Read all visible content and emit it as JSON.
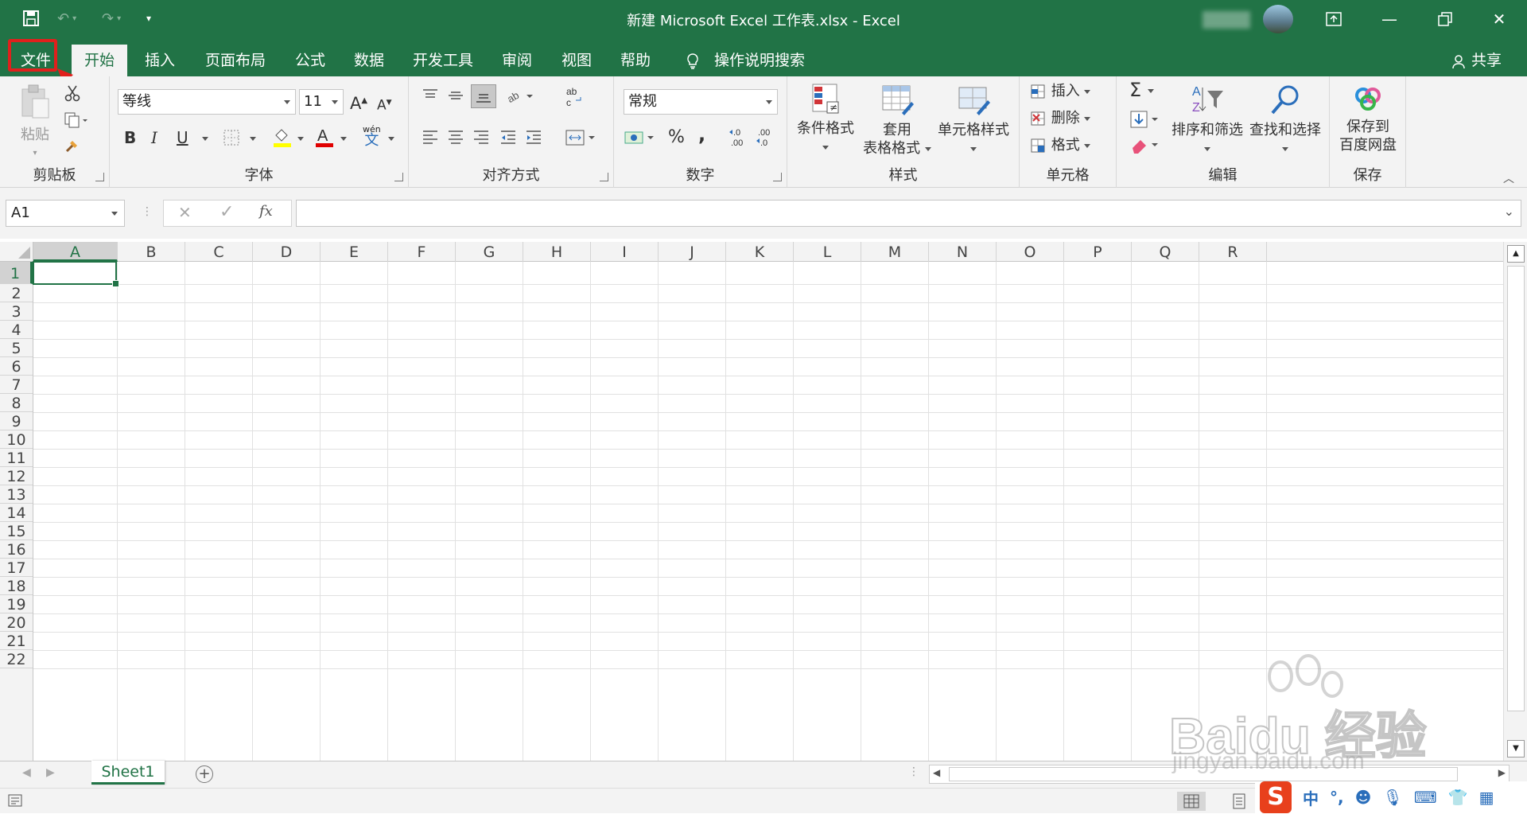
{
  "window": {
    "title": "新建 Microsoft Excel 工作表.xlsx  -  Excel"
  },
  "tabs": [
    {
      "label": "文件"
    },
    {
      "label": "开始"
    },
    {
      "label": "插入"
    },
    {
      "label": "页面布局"
    },
    {
      "label": "公式"
    },
    {
      "label": "数据"
    },
    {
      "label": "开发工具"
    },
    {
      "label": "审阅"
    },
    {
      "label": "视图"
    },
    {
      "label": "帮助"
    }
  ],
  "tell_me": "操作说明搜索",
  "share": "共享",
  "ribbon": {
    "clipboard": {
      "label": "剪贴板",
      "paste": "粘贴"
    },
    "font": {
      "label": "字体",
      "name": "等线",
      "size": "11",
      "bold": "B",
      "italic": "I",
      "underline": "U",
      "phonetic": "wén",
      "phonetic2": "文"
    },
    "alignment": {
      "label": "对齐方式"
    },
    "number": {
      "label": "数字",
      "format": "常规",
      "percent": "%",
      "comma": ","
    },
    "styles": {
      "label": "样式",
      "conditional": "条件格式",
      "table_1": "套用",
      "table_2": "表格格式",
      "cell_styles": "单元格样式"
    },
    "cells": {
      "label": "单元格",
      "insert": "插入",
      "delete": "删除",
      "format": "格式"
    },
    "editing": {
      "label": "编辑",
      "sort": "排序和筛选",
      "find": "查找和选择"
    },
    "save": {
      "label": "保存",
      "btn_1": "保存到",
      "btn_2": "百度网盘"
    }
  },
  "formula_bar": {
    "name_box": "A1",
    "fx": "fx",
    "value": ""
  },
  "columns": [
    "A",
    "B",
    "C",
    "D",
    "E",
    "F",
    "G",
    "H",
    "I",
    "J",
    "K",
    "L",
    "M",
    "N",
    "O",
    "P",
    "Q",
    "R"
  ],
  "rows": [
    "1",
    "2",
    "3",
    "4",
    "5",
    "6",
    "7",
    "8",
    "9",
    "10",
    "11",
    "12",
    "13",
    "14",
    "15",
    "16",
    "17",
    "18",
    "19",
    "20",
    "21",
    "22"
  ],
  "selected_cell": "A1",
  "sheets": [
    {
      "name": "Sheet1"
    }
  ],
  "watermark": {
    "line1": "Baidu 经验",
    "line2": "jingyan.baidu.com"
  },
  "ime": {
    "label": "中"
  },
  "colors": {
    "accent": "#217346",
    "highlight": "#e0201c"
  }
}
